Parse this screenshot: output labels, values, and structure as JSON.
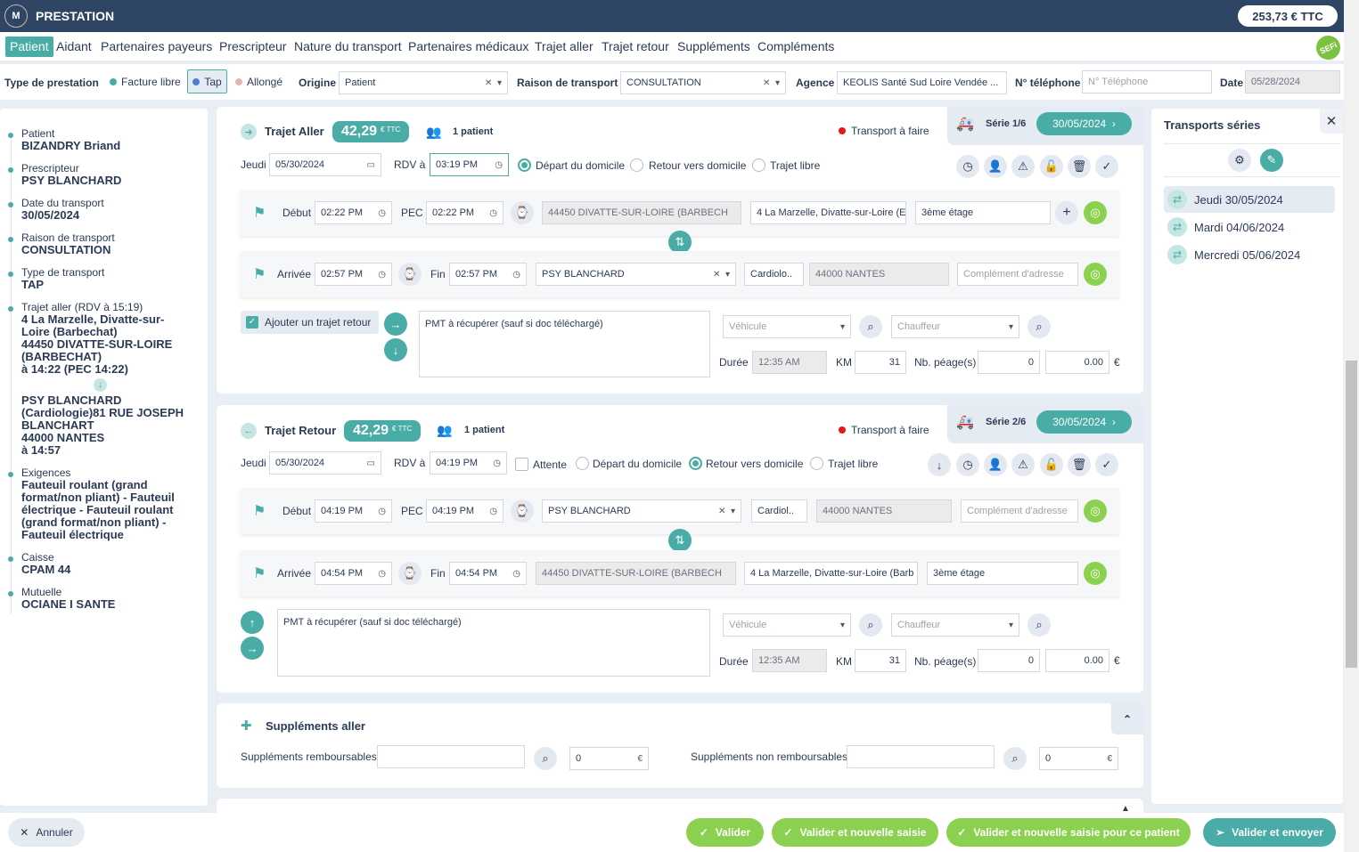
{
  "header": {
    "logo": "M",
    "title": "PRESTATION",
    "total": "253,73 € TTC"
  },
  "nav": {
    "tabs": [
      "Patient",
      "Aidant",
      "Partenaires payeurs",
      "Prescripteur",
      "Nature du transport",
      "Partenaires médicaux",
      "Trajet aller",
      "Trajet retour",
      "Suppléments",
      "Compléments"
    ],
    "sefi": "SEFi"
  },
  "filters": {
    "type_label": "Type de prestation",
    "types": [
      "Facture libre",
      "Tap",
      "Allongé"
    ],
    "type_colors": [
      "#4aaca6",
      "#4a7fd1",
      "#e0b5b5"
    ],
    "origine_label": "Origine",
    "origine": "Patient",
    "raison_label": "Raison de transport",
    "raison": "CONSULTATION",
    "agence_label": "Agence",
    "agence": "KEOLIS Santé Sud Loire Vendée ...",
    "tel_label": "N° téléphone",
    "tel_placeholder": "N° Téléphone",
    "date_label": "Date",
    "date": "05/28/2024"
  },
  "summary": [
    {
      "k": "Patient",
      "v": "BIZANDRY Briand"
    },
    {
      "k": "Prescripteur",
      "v": "PSY BLANCHARD"
    },
    {
      "k": "Date du transport",
      "v": "30/05/2024"
    },
    {
      "k": "Raison de transport",
      "v": "CONSULTATION"
    },
    {
      "k": "Type de transport",
      "v": "TAP"
    },
    {
      "k": "Trajet aller (RDV à 15:19)",
      "v": "4 La Marzelle, Divatte-sur-Loire (Barbechat)\n44450 DIVATTE-SUR-LOIRE (BARBECHAT)\nà 14:22 (PEC 14:22)",
      "v2": "PSY BLANCHARD (Cardiologie)81 RUE JOSEPH BLANCHART\n44000 NANTES\nà 14:57"
    },
    {
      "k": "Exigences",
      "v": "Fauteuil roulant (grand format/non pliant) - Fauteuil électrique - Fauteuil roulant (grand format/non pliant) - Fauteuil électrique"
    },
    {
      "k": "Caisse",
      "v": "CPAM 44"
    },
    {
      "k": "Mutuelle",
      "v": "OCIANE I SANTE"
    }
  ],
  "common": {
    "price": "42,29",
    "ttc": "€ TTC",
    "patients": "1 patient",
    "status": "Transport à faire",
    "status_color": "#e8141b",
    "jeudi": "Jeudi",
    "rdv": "RDV à",
    "depart": "Départ du domicile",
    "retour": "Retour vers domicile",
    "libre": "Trajet libre",
    "debut": "Début",
    "pec": "PEC",
    "arrivee": "Arrivée",
    "fin": "Fin",
    "compl_ph": "Complément d'adresse",
    "vehicule": "Véhicule",
    "chauffeur": "Chauffeur",
    "duree": "Durée",
    "km": "KM",
    "peage": "Nb. péage(s)",
    "euro": "€",
    "note": "PMT à récupérer (sauf si doc téléchargé)"
  },
  "aller": {
    "title": "Trajet Aller",
    "serie": "Série 1/6",
    "serie_date": "30/05/2024",
    "date": "05/30/2024",
    "rdv": "03:19 PM",
    "debut": "02:22 PM",
    "pec": "02:22 PM",
    "from_select": "44450 DIVATTE-SUR-LOIRE (BARBECH",
    "from_addr": "4 La Marzelle, Divatte-sur-Loire (E",
    "from_compl": "3ème étage",
    "arrivee": "02:57 PM",
    "fin": "02:57 PM",
    "to_select": "PSY BLANCHARD",
    "to_spec": "Cardiolo..",
    "to_city": "44000 NANTES",
    "retour_check": "Ajouter un trajet retour",
    "duree": "12:35 AM",
    "km": "31",
    "peage": "0",
    "peage_amt": "0.00"
  },
  "retour": {
    "title": "Trajet Retour",
    "serie": "Série 2/6",
    "serie_date": "30/05/2024",
    "date": "05/30/2024",
    "rdv": "04:19 PM",
    "attente": "Attente",
    "debut": "04:19 PM",
    "pec": "04:19 PM",
    "from_select": "PSY BLANCHARD",
    "from_spec": "Cardiol..",
    "from_city": "44000 NANTES",
    "arrivee": "04:54 PM",
    "fin": "04:54 PM",
    "to_select": "44450 DIVATTE-SUR-LOIRE (BARBECH",
    "to_addr": "4 La Marzelle, Divatte-sur-Loire (Barb",
    "to_compl": "3ème étage",
    "duree": "12:35 AM",
    "km": "31",
    "peage": "0",
    "peage_amt": "0.00"
  },
  "supplements": {
    "title": "Suppléments aller",
    "remb": "Suppléments remboursables",
    "remb_amt": "0",
    "nonremb": "Suppléments non remboursables",
    "nonremb_amt": "0"
  },
  "series": {
    "title": "Transports séries",
    "items": [
      "Jeudi 30/05/2024",
      "Mardi 04/06/2024",
      "Mercredi 05/06/2024"
    ]
  },
  "footer": {
    "cancel": "Annuler",
    "valider": "Valider",
    "valider_nouvelle": "Valider et nouvelle saisie",
    "valider_patient": "Valider et nouvelle saisie pour ce patient",
    "valider_envoyer": "Valider et envoyer"
  }
}
